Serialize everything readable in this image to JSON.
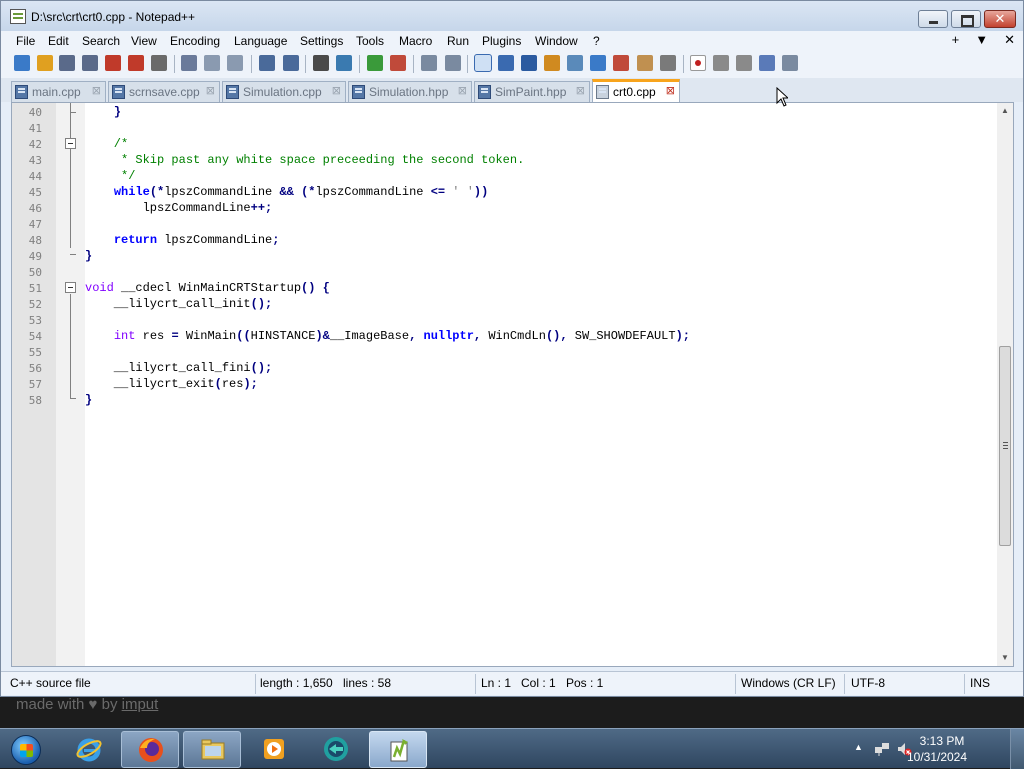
{
  "window": {
    "title": "D:\\src\\crt\\crt0.cpp - Notepad++",
    "close_glyph": "✕"
  },
  "menu": {
    "items": [
      "File",
      "Edit",
      "Search",
      "View",
      "Encoding",
      "Language",
      "Settings",
      "Tools",
      "Macro",
      "Run",
      "Plugins",
      "Window",
      "?"
    ],
    "right": [
      "+",
      "▼",
      "✕"
    ]
  },
  "toolbar": {
    "buttons": [
      "new-file-icon",
      "open-file-icon",
      "save-icon",
      "save-all-icon",
      "close-icon",
      "close-all-icon",
      "print-icon",
      "cut-icon",
      "copy-icon",
      "paste-icon",
      "undo-icon",
      "redo-icon",
      "find-icon",
      "replace-icon",
      "zoom-in-icon",
      "zoom-out-icon",
      "sync-vertical-icon",
      "sync-horizontal-icon",
      "word-wrap-icon",
      "show-all-chars-icon",
      "indent-guide-icon",
      "user-lang-icon",
      "doc-map-icon",
      "doc-list-icon",
      "function-list-icon",
      "folder-workspace-icon",
      "monitoring-icon",
      "record-macro-icon",
      "stop-macro-icon",
      "play-macro-icon",
      "run-macro-multiple-icon",
      "save-macro-icon"
    ]
  },
  "tabs": [
    {
      "label": "main.cpp",
      "active": false
    },
    {
      "label": "scrnsave.cpp",
      "active": false
    },
    {
      "label": "Simulation.cpp",
      "active": false
    },
    {
      "label": "Simulation.hpp",
      "active": false
    },
    {
      "label": "SimPaint.hpp",
      "active": false
    },
    {
      "label": "crt0.cpp",
      "active": true
    }
  ],
  "tab_close_glyph": "⊠",
  "editor": {
    "lines": [
      {
        "n": "40",
        "code": "    }"
      },
      {
        "n": "41",
        "code": ""
      },
      {
        "n": "42",
        "code": "    /*"
      },
      {
        "n": "43",
        "code": "     * Skip past any white space preceeding the second token."
      },
      {
        "n": "44",
        "code": "     */"
      },
      {
        "n": "45",
        "code": "    while(*lpszCommandLine && (*lpszCommandLine <= ' '))"
      },
      {
        "n": "46",
        "code": "        lpszCommandLine++;"
      },
      {
        "n": "47",
        "code": ""
      },
      {
        "n": "48",
        "code": "    return lpszCommandLine;"
      },
      {
        "n": "49",
        "code": "}"
      },
      {
        "n": "50",
        "code": ""
      },
      {
        "n": "51",
        "code": "void __cdecl WinMainCRTStartup() {"
      },
      {
        "n": "52",
        "code": "    __lilycrt_call_init();"
      },
      {
        "n": "53",
        "code": ""
      },
      {
        "n": "54",
        "code": "    int res = WinMain((HINSTANCE)&__ImageBase, nullptr, WinCmdLn(), SW_SHOWDEFAULT);"
      },
      {
        "n": "55",
        "code": ""
      },
      {
        "n": "56",
        "code": "    __lilycrt_call_fini();"
      },
      {
        "n": "57",
        "code": "    __lilycrt_exit(res);"
      },
      {
        "n": "58",
        "code": "}"
      }
    ]
  },
  "status": {
    "filetype": "C++ source file",
    "length": "length : 1,650",
    "lines": "lines : 58",
    "ln": "Ln : 1",
    "col": "Col : 1",
    "pos": "Pos : 1",
    "eol": "Windows (CR LF)",
    "encoding": "UTF-8",
    "mode": "INS"
  },
  "watermark": {
    "prefix": "made with ♥ by",
    "link": "imput"
  },
  "taskbar": {
    "apps": [
      "internet-explorer",
      "firefox",
      "file-explorer",
      "media-player",
      "teamviewer",
      "notepad++"
    ],
    "time": "3:13 PM",
    "date": "10/31/2024"
  }
}
